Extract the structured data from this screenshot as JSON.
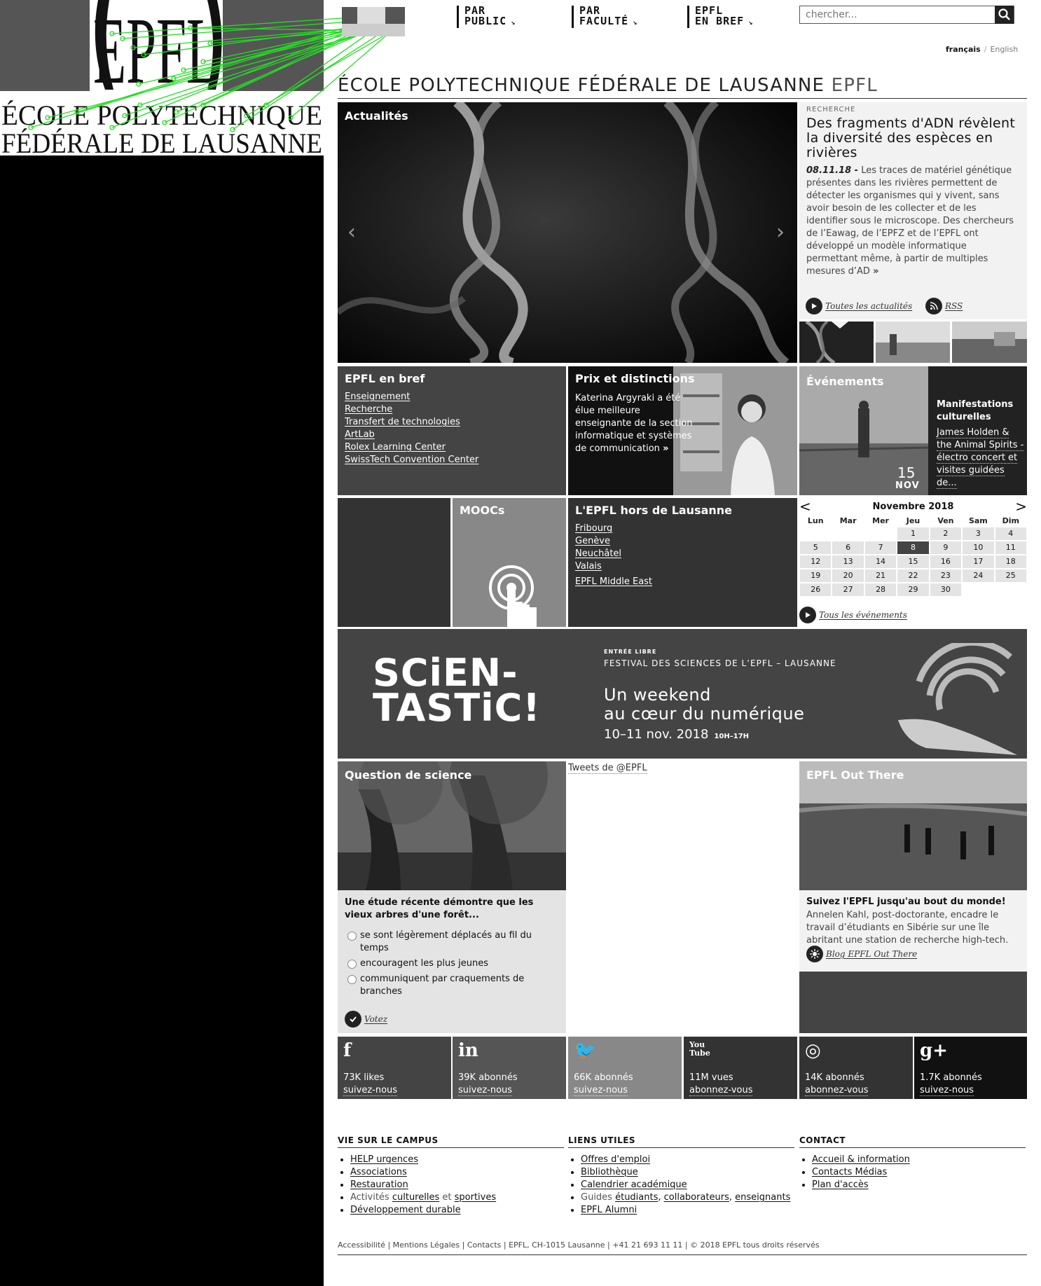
{
  "header": {
    "nav": [
      {
        "line1": "PAR",
        "line2": "PUBLIC"
      },
      {
        "line1": "PAR",
        "line2": "FACULTÉ"
      },
      {
        "line1": "EPFL",
        "line2": "EN BREF"
      }
    ],
    "search_placeholder": "chercher...",
    "lang_current": "français",
    "lang_other": "English"
  },
  "logo": {
    "mark": "EPFL",
    "line1": "ÉCOLE POLYTECHNIQUE",
    "line2": "FÉDÉRALE DE LAUSANNE"
  },
  "page_title": {
    "main": "ÉCOLE POLYTECHNIQUE FÉDÉRALE DE LAUSANNE",
    "abbr": "EPFL"
  },
  "actualites": {
    "label": "Actualités",
    "category": "RECHERCHE",
    "headline": "Des fragments d'ADN révèlent la diversité des espèces en rivières",
    "date": "08.11.18 -",
    "body": "Les traces de matériel génétique présentes dans les rivières permettent de détecter les organismes qui y vivent, sans avoir besoin de les collecter et de les identifier sous le microscope. Des chercheurs de l’Eawag, de l’EPFZ et de l’EPFL ont développé un modèle informatique permettant même, à partir de multiples mesures d’AD",
    "more": "»",
    "all_news": "Toutes les actualités",
    "rss": "RSS"
  },
  "bref": {
    "title": "EPFL en bref",
    "links": [
      "Enseignement",
      "Recherche",
      "Transfert de technologies",
      "ArtLab",
      "Rolex Learning Center",
      "SwissTech Convention Center"
    ]
  },
  "prix": {
    "title": "Prix et distinctions",
    "text": "Katerina Argyraki a été élue meilleure enseignante de la section informatique et systèmes de communication",
    "more": "»"
  },
  "events": {
    "title": "Événements",
    "category": "Manifestations culturelles",
    "event": "James Holden & the Animal Spirits - électro concert et visites guidées de...",
    "day": "15",
    "month": "NOV"
  },
  "moocs": {
    "title": "MOOCs"
  },
  "hors": {
    "title": "L'EPFL hors de Lausanne",
    "links": [
      "Fribourg",
      "Genève",
      "Neuchâtel",
      "Valais"
    ],
    "extra": "EPFL Middle East"
  },
  "calendar": {
    "prev": "<",
    "next": ">",
    "month": "Novembre 2018",
    "days": [
      "Lun",
      "Mar",
      "Mer",
      "Jeu",
      "Ven",
      "Sam",
      "Dim"
    ],
    "dates": [
      "",
      "",
      "",
      "1",
      "2",
      "3",
      "4",
      "5",
      "6",
      "7",
      "8",
      "9",
      "10",
      "11",
      "12",
      "13",
      "14",
      "15",
      "16",
      "17",
      "18",
      "19",
      "20",
      "21",
      "22",
      "23",
      "24",
      "25",
      "26",
      "27",
      "28",
      "29",
      "30",
      "",
      ""
    ],
    "today": "8",
    "all_events": "Tous les événements"
  },
  "banner": {
    "title1": "SCiEN-",
    "title2": "TASTiC!",
    "entree": "ENTRÉE LIBRE",
    "festival": "FESTIVAL DES SCIENCES DE L’EPFL – LAUSANNE",
    "sub1": "Un weekend",
    "sub2": "au cœur du numérique",
    "date": "10–11 nov. 2018",
    "time": "10H–17H"
  },
  "question": {
    "title": "Question de science",
    "text": "Une étude récente démontre que les vieux arbres d'une forêt...",
    "options": [
      "se sont légèrement déplacés au fil du temps",
      "encouragent les plus jeunes",
      "communiquent par craquements de branches"
    ],
    "vote": "Votez"
  },
  "tweets": {
    "label": "Tweets de @EPFL"
  },
  "outthere": {
    "title": "EPFL Out There",
    "head": "Suivez l'EPFL jusqu'au bout du monde!",
    "text": "Annelen Kahl, post-doctorante, encadre le travail d’étudiants en Sibérie sur une île abritant une station de recherche high-tech.",
    "link": "Blog EPFL Out There"
  },
  "social": [
    {
      "icon": "f",
      "stat": "73K likes",
      "follow": "suivez-nous",
      "bg": "#444444"
    },
    {
      "icon": "in",
      "stat": "39K abonnés",
      "follow": "suivez-nous",
      "bg": "#555555"
    },
    {
      "icon": "🐦",
      "stat": "66K abonnés",
      "follow": "suivez-nous",
      "bg": "#888888"
    },
    {
      "icon": "You Tube",
      "stat": "11M vues",
      "follow": "abonnez-vous",
      "bg": "#333333"
    },
    {
      "icon": "◎",
      "stat": "14K abonnés",
      "follow": "abonnez-vous",
      "bg": "#333333"
    },
    {
      "icon": "g+",
      "stat": "1.7K abonnés",
      "follow": "suivez-nous",
      "bg": "#111111"
    }
  ],
  "footer": {
    "campus": {
      "title": "VIE SUR LE CAMPUS",
      "links": [
        "HELP urgences",
        "Associations",
        "Restauration"
      ],
      "activites_prefix": "Activités",
      "activites_a": "culturelles",
      "activites_et": "et",
      "activites_b": "sportives",
      "last": "Développement durable"
    },
    "liens": {
      "title": "LIENS UTILES",
      "links": [
        "Offres d'emploi",
        "Bibliothèque",
        "Calendrier académique"
      ],
      "guides_prefix": "Guides",
      "guides_a": "étudiants",
      "guides_b": "collaborateurs",
      "guides_c": "enseignants",
      "last": "EPFL Alumni"
    },
    "contact": {
      "title": "CONTACT",
      "links": [
        "Accueil & information",
        "Contacts Médias",
        "Plan d'accès"
      ]
    },
    "bottom": "Accessibilité | Mentions Légales | Contacts | EPFL, CH-1015 Lausanne | +41 21 693 11 11 | © 2018 EPFL tous droits réservés"
  },
  "colors": {
    "accent": "#222222",
    "tile_dark": "#444444",
    "tile_mid": "#888888",
    "link_line": "#22dd22"
  }
}
